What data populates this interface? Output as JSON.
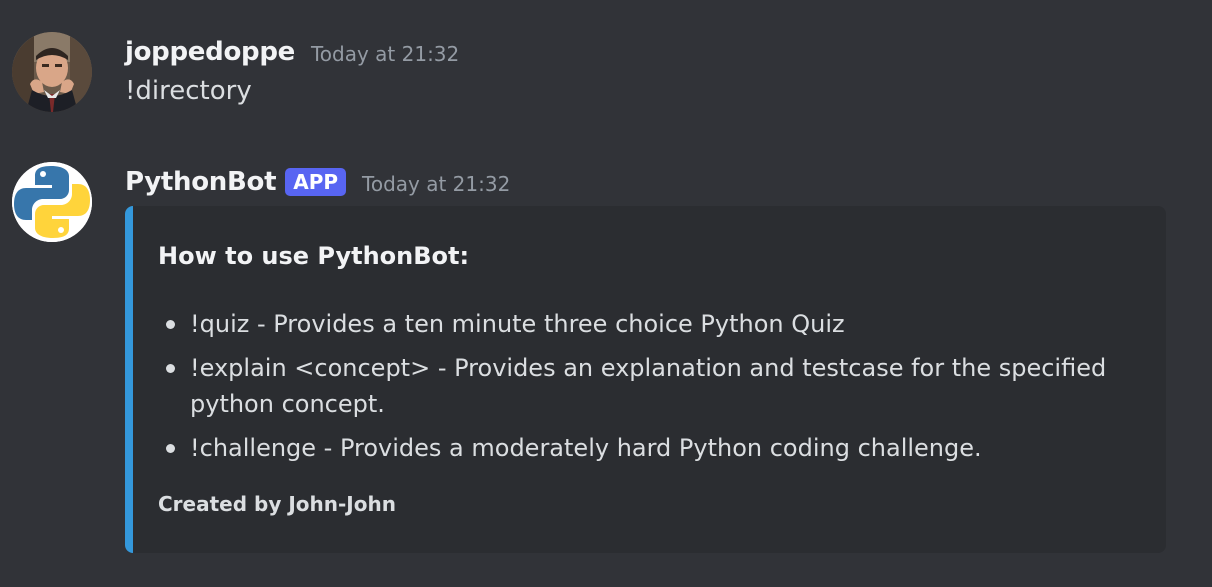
{
  "messages": [
    {
      "username": "joppedoppe",
      "timestamp": "Today at 21:32",
      "content": "!directory"
    },
    {
      "username": "PythonBot",
      "badge": "APP",
      "timestamp": "Today at 21:32",
      "embed": {
        "accent_color": "#3498db",
        "title": "How to use PythonBot:",
        "items": [
          "!quiz - Provides a ten minute three choice Python Quiz",
          "!explain <concept> - Provides an explanation and testcase for the specified python concept.",
          "!challenge - Provides a moderately hard Python coding challenge."
        ],
        "footer": "Created by John-John"
      }
    }
  ],
  "colors": {
    "background": "#313338",
    "embed_background": "#2b2d31",
    "badge": "#5865f2",
    "timestamp": "#949ba4"
  },
  "icons": {
    "user_avatar": "user-photo-avatar",
    "bot_avatar": "python-logo-avatar"
  }
}
